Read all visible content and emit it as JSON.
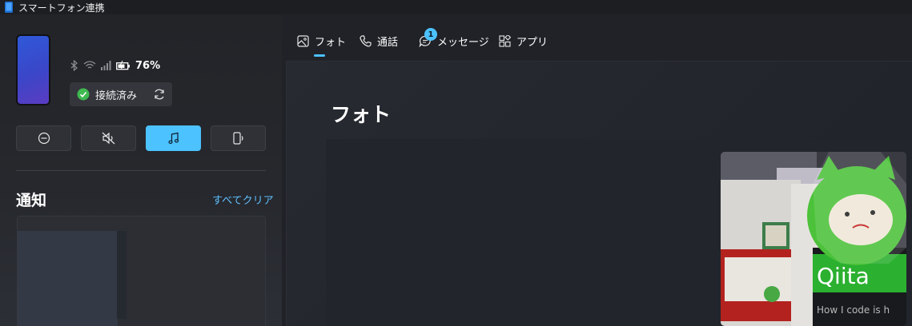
{
  "window": {
    "title": "スマートフォン連携"
  },
  "device": {
    "battery_percent": "76%",
    "connection_status": "接続済み"
  },
  "quick_actions": [
    {
      "name": "do-not-disturb",
      "active": false
    },
    {
      "name": "mute",
      "active": false
    },
    {
      "name": "media",
      "active": true
    },
    {
      "name": "audio-output",
      "active": false
    }
  ],
  "notifications": {
    "title": "通知",
    "clear_all": "すべてクリア"
  },
  "tabs": [
    {
      "label": "フォト",
      "selected": true
    },
    {
      "label": "通話",
      "selected": false
    },
    {
      "label": "メッセージ",
      "selected": false,
      "badge": "1"
    },
    {
      "label": "アプリ",
      "selected": false
    }
  ],
  "content": {
    "title": "フォト"
  },
  "photo": {
    "sign_text": "Qiita",
    "caption_text": "How I code is h"
  },
  "colors": {
    "accent": "#4cc2ff",
    "connected_green": "#3fb950",
    "background": "#202227"
  }
}
